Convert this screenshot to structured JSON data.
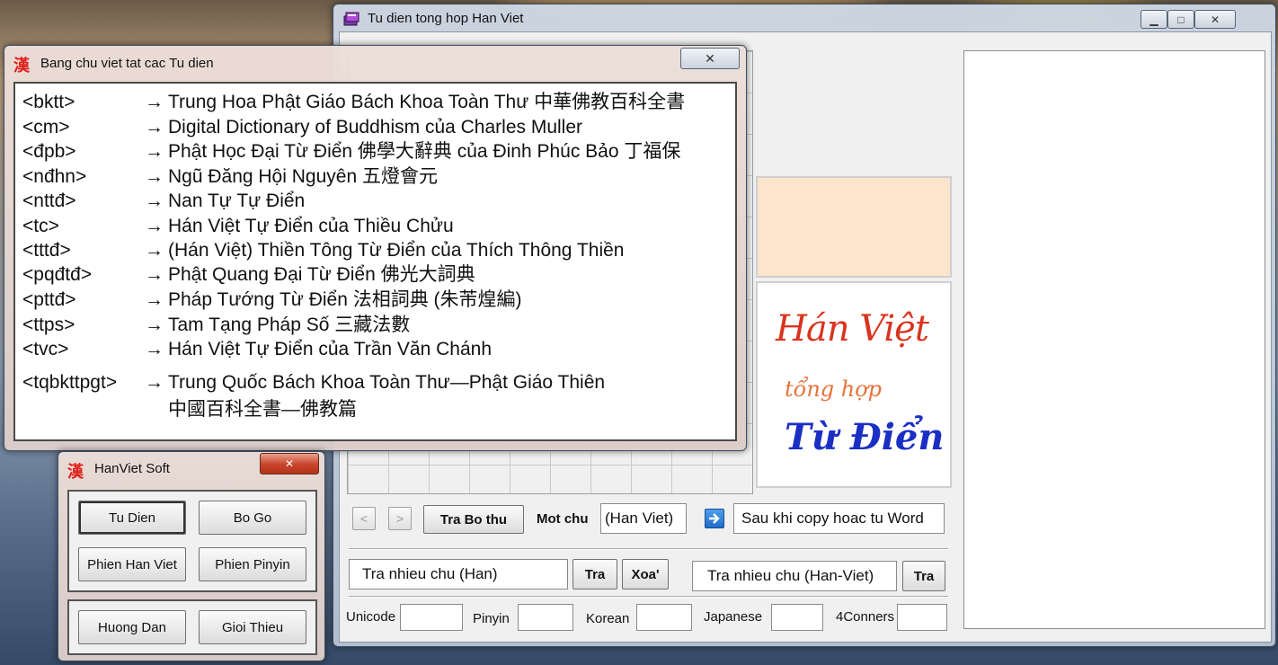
{
  "main_window": {
    "title": "Tu dien tong hop Han Viet",
    "controls": {
      "minimize": "▁",
      "maximize": "□",
      "close": "✕"
    },
    "nav": {
      "prev": "<",
      "next": ">"
    },
    "tra_bo_thu_button": "Tra Bo thu",
    "mot_chu_label": "Mot chu",
    "mot_chu_value": "(Han Viet)",
    "copy_field_value": "Sau khi copy hoac tu Word",
    "han_input_value": "Tra nhieu chu (Han)",
    "tra_button_1": "Tra",
    "xoa_button": "Xoa'",
    "hanviet_input_value": "Tra nhieu chu (Han-Viet)",
    "tra_button_2": "Tra",
    "code_fields": [
      "Unicode",
      "Pinyin",
      "Korean",
      "Japanese",
      "4Conners"
    ],
    "logo": {
      "line1": "Hán Việt",
      "line2": "tổng hợp",
      "line3": "Từ Điển"
    }
  },
  "abbr_dialog": {
    "title": "Bang chu viet tat cac Tu dien",
    "icon_char": "漢",
    "close": "✕",
    "arrow": "→",
    "entries": [
      {
        "key": "<bktt>",
        "desc": "Trung Hoa Phật Giáo Bách Khoa Toàn Thư 中華佛教百科全書"
      },
      {
        "key": "<cm>",
        "desc": "Digital Dictionary of Buddhism của Charles Muller"
      },
      {
        "key": "<đpb>",
        "desc": "Phật Học Đại Từ Điển 佛學大辭典 của Đinh Phúc Bảo 丁福保"
      },
      {
        "key": "<nđhn>",
        "desc": "Ngũ Đăng Hội Nguyên 五燈會元"
      },
      {
        "key": "<nttđ>",
        "desc": "Nan Tự Tự Điển"
      },
      {
        "key": "<tc>",
        "desc": "Hán Việt Tự Điển của Thiều Chửu"
      },
      {
        "key": "<tttđ>",
        "desc": "(Hán Việt) Thiền Tông Từ Điển của Thích Thông Thiền"
      },
      {
        "key": "<pqđtđ>",
        "desc": "Phật Quang Đại Từ Điển 佛光大詞典"
      },
      {
        "key": "<pttđ>",
        "desc": "Pháp Tướng Từ Điển 法相詞典 (朱芾煌編)"
      },
      {
        "key": "<ttps>",
        "desc": "Tam Tạng Pháp Số 三藏法數"
      },
      {
        "key": "<tvc>",
        "desc": "Hán Việt Tự Điển của Trần Văn Chánh"
      },
      {
        "key": "<tqbkttpgt>",
        "desc": "Trung Quốc Bách Khoa Toàn Thư—Phật Giáo Thiên",
        "desc2": "中國百科全書—佛教篇"
      }
    ]
  },
  "hanviet_soft": {
    "title": "HanViet Soft",
    "icon_char": "漢",
    "close": "✕",
    "buttons": {
      "tu_dien": "Tu Dien",
      "bo_go": "Bo Go",
      "phien_han_viet": "Phien Han Viet",
      "phien_pinyin": "Phien Pinyin",
      "huong_dan": "Huong Dan",
      "gioi_thieu": "Gioi Thieu"
    }
  },
  "colors": {
    "icon_red": "#e0201a",
    "peach_panel": "#fde4cc",
    "logo_red": "#d9341f",
    "logo_orange": "#e8733a",
    "logo_blue": "#1b2fc4"
  }
}
